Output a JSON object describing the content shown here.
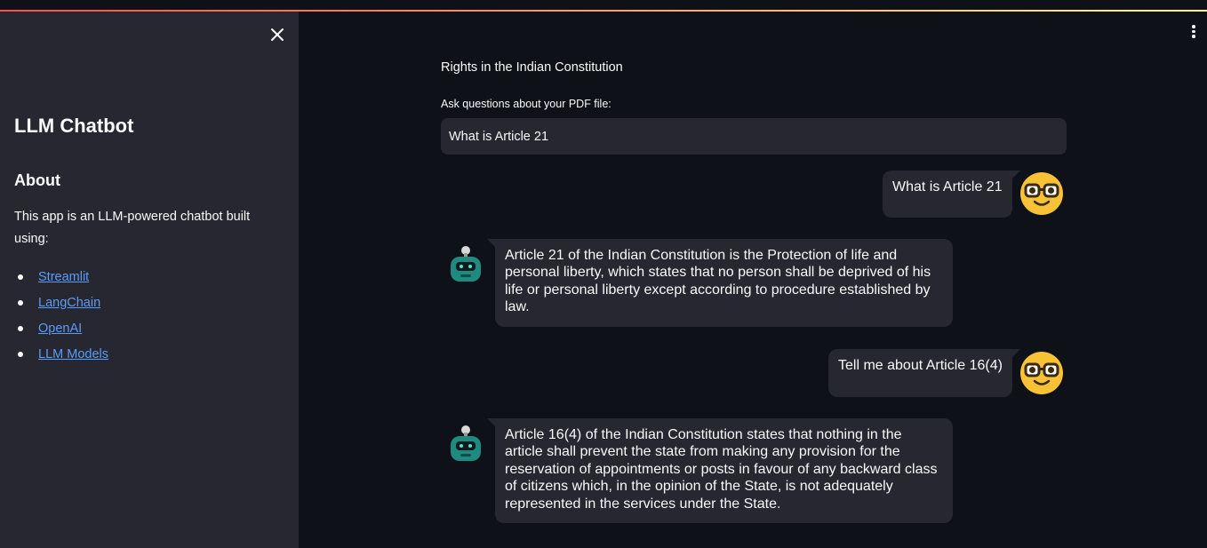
{
  "sidebar": {
    "title": "LLM Chatbot",
    "about_heading": "About",
    "description": "This app is an LLM-powered chatbot built using:",
    "links": [
      "Streamlit",
      "LangChain",
      "OpenAI",
      "LLM Models"
    ],
    "close_icon": "close-icon"
  },
  "main": {
    "title": "Rights in the Indian Constitution",
    "input_label": "Ask questions about your PDF file:",
    "input_value": "What is Article 21"
  },
  "messages": [
    {
      "role": "user",
      "text": "What is Article 21"
    },
    {
      "role": "assistant",
      "text": "Article 21 of the Indian Constitution is the Protection of life and personal liberty, which states that no person shall be deprived of his life or personal liberty except according to procedure established by law."
    },
    {
      "role": "user",
      "text": "Tell me about Article 16(4)"
    },
    {
      "role": "assistant",
      "text": "Article 16(4) of the Indian Constitution states that nothing in the article shall prevent the state from making any provision for the reservation of appointments or posts in favour of any backward class of citizens which, in the opinion of the State, is not adequately represented in the services under the State."
    }
  ],
  "colors": {
    "background": "#0e1117",
    "sidebar": "#262730",
    "bubble": "#262730",
    "link": "#5a9cf8",
    "user_avatar": "#f8c237",
    "bot_avatar": "#1f8a80"
  },
  "icons": {
    "menu": "more-vertical-icon",
    "user_avatar": "nerd-face-icon",
    "bot_avatar": "robot-icon"
  }
}
